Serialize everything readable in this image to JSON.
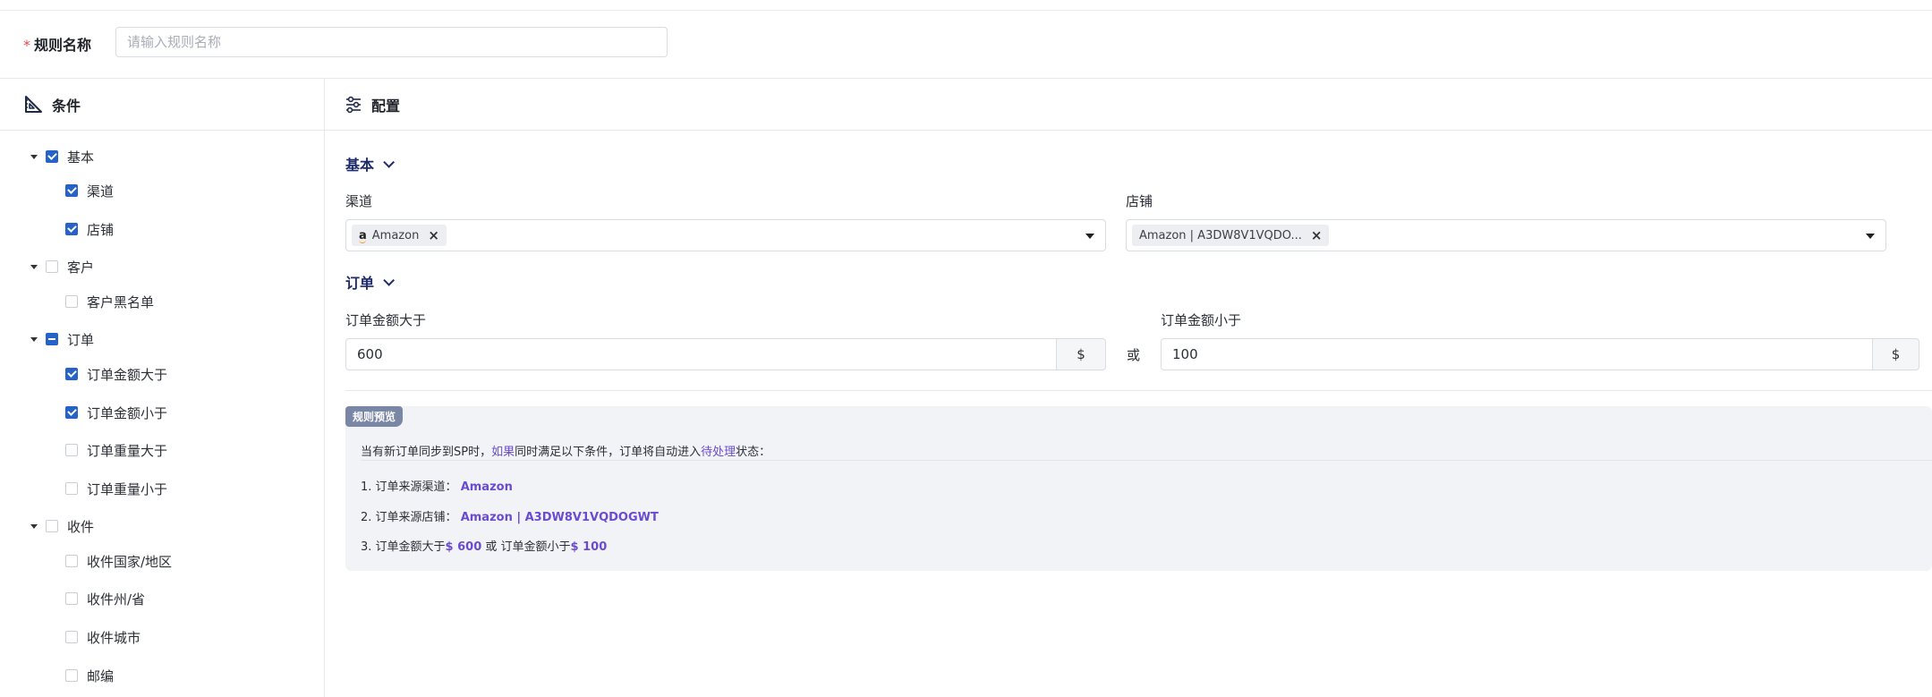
{
  "rule": {
    "label": "规则名称",
    "required_mark": "*",
    "placeholder": "请输入规则名称"
  },
  "conditions_panel": {
    "title": "条件",
    "groups": [
      {
        "label": "基本",
        "state": "checked",
        "items": [
          {
            "label": "渠道",
            "checked": true
          },
          {
            "label": "店铺",
            "checked": true
          }
        ]
      },
      {
        "label": "客户",
        "state": "unchecked",
        "items": [
          {
            "label": "客户黑名单",
            "checked": false
          }
        ]
      },
      {
        "label": "订单",
        "state": "indeterminate",
        "items": [
          {
            "label": "订单金额大于",
            "checked": true
          },
          {
            "label": "订单金额小于",
            "checked": true
          },
          {
            "label": "订单重量大于",
            "checked": false
          },
          {
            "label": "订单重量小于",
            "checked": false
          }
        ]
      },
      {
        "label": "收件",
        "state": "unchecked",
        "items": [
          {
            "label": "收件国家/地区",
            "checked": false
          },
          {
            "label": "收件州/省",
            "checked": false
          },
          {
            "label": "收件城市",
            "checked": false
          },
          {
            "label": "邮编",
            "checked": false
          }
        ]
      }
    ]
  },
  "config_panel": {
    "title": "配置",
    "basic": {
      "title": "基本",
      "channel_label": "渠道",
      "channel_tag": "Amazon",
      "channel_tag_icon": "a",
      "store_label": "店铺",
      "store_tag": "Amazon | A3DW8V1VQDO..."
    },
    "order": {
      "title": "订单",
      "gt_label": "订单金额大于",
      "gt_value": "600",
      "gt_suffix": "$",
      "or_text": "或",
      "lt_label": "订单金额小于",
      "lt_value": "100",
      "lt_suffix": "$"
    },
    "preview": {
      "badge": "规则预览",
      "intro_pre": "当有新订单同步到SP时，",
      "intro_if": "如果",
      "intro_mid": "同时满足以下条件，订单将自动进入",
      "intro_status": "待处理",
      "intro_post": "状态：",
      "line1_pre": "1. 订单来源渠道：",
      "line1_val": "Amazon",
      "line2_pre": "2. 订单来源店铺：",
      "line2_val": "Amazon | A3DW8V1VQDOGWT",
      "line3_pre": "3. 订单金额大于",
      "line3_val1": "$ 600",
      "line3_mid": " 或 订单金额小于",
      "line3_val2": "$ 100"
    }
  }
}
